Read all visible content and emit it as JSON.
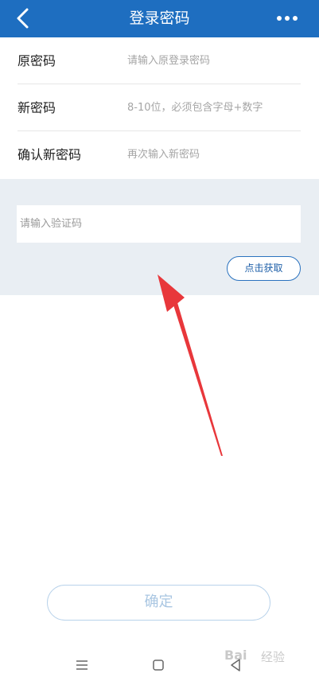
{
  "header": {
    "title": "登录密码",
    "back_icon": "chevron-left-icon",
    "more_icon": "more-dots-icon",
    "bg_color": "#1e6ec0"
  },
  "form": {
    "rows": [
      {
        "label": "原密码",
        "placeholder": "请输入原登录密码",
        "value": ""
      },
      {
        "label": "新密码",
        "placeholder": "8-10位，必须包含字母+数字",
        "value": ""
      },
      {
        "label": "确认新密码",
        "placeholder": "再次输入新密码",
        "value": ""
      }
    ]
  },
  "verification": {
    "placeholder": "请输入验证码",
    "value": "",
    "get_code_label": "点击获取"
  },
  "confirm_label": "确定",
  "annotation": {
    "arrow_color": "#e8373b"
  },
  "nav_bar": {
    "menu_icon": "menu-icon",
    "home_icon": "home-square-icon",
    "back_icon": "triangle-back-icon"
  },
  "watermark": {
    "text": "Bai",
    "sub": "经验"
  }
}
